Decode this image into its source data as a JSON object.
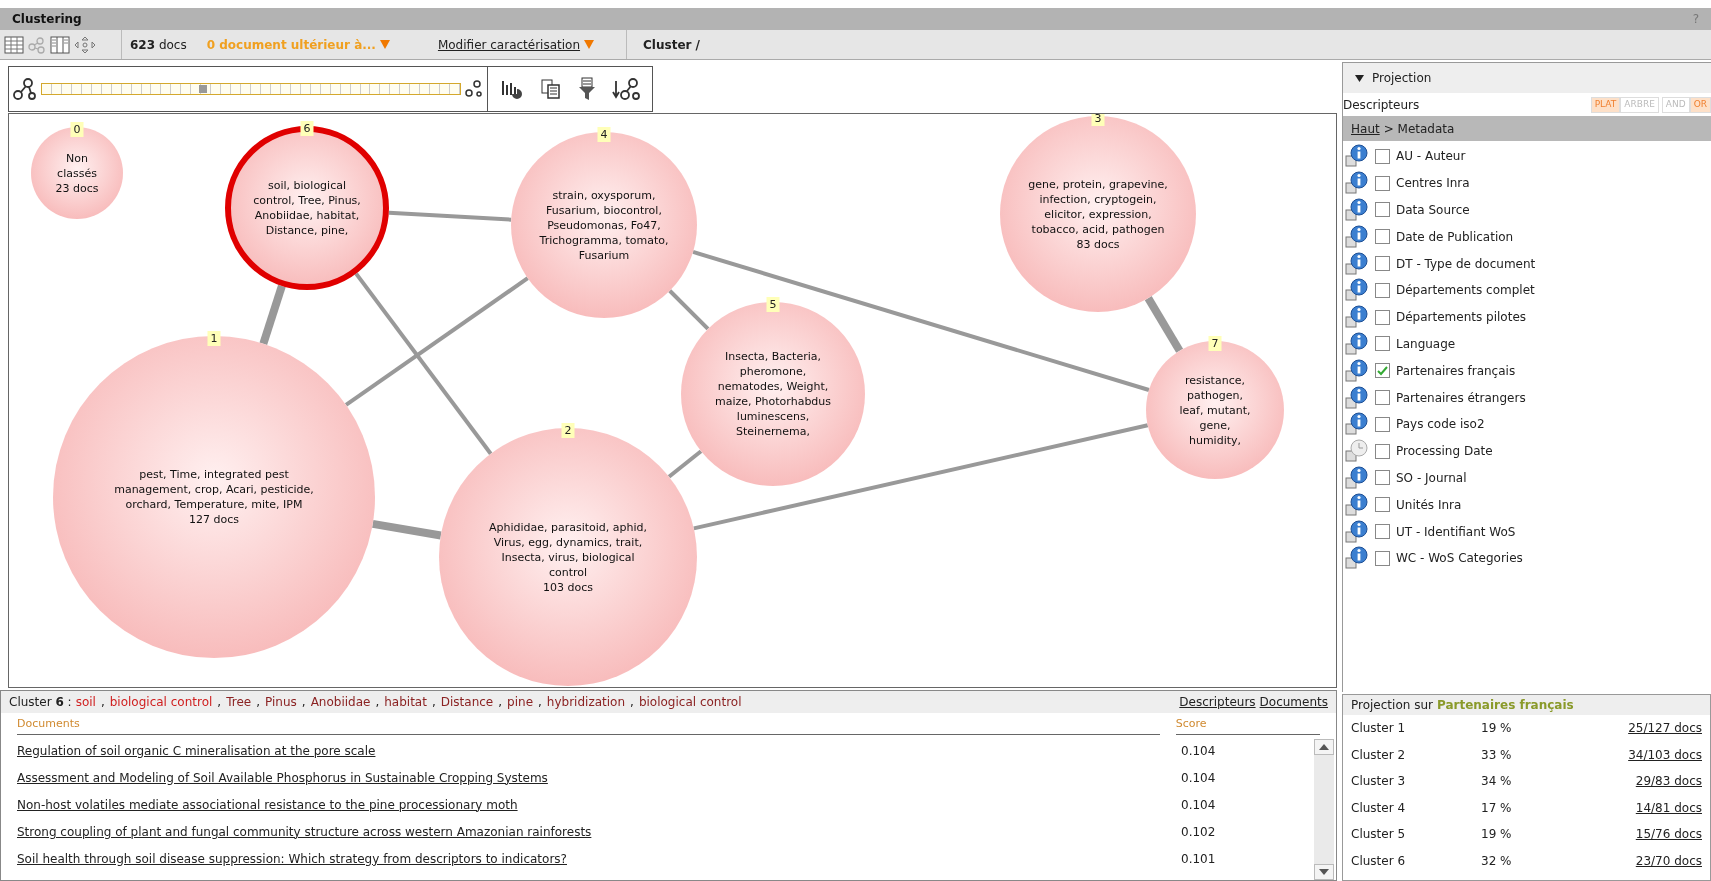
{
  "window": {
    "title": "Clustering",
    "help": "?"
  },
  "toolbar": {
    "doc_count": "**623** docs",
    "later_docs": "0 document ultérieur à...",
    "modify_link": "Modifier caractérisation",
    "cluster_path": "Cluster /"
  },
  "granularity_slider": {
    "level": 0.385
  },
  "nodes": [
    {
      "number": "0",
      "text": "Non classés",
      "docs": "23 docs",
      "selected": false
    },
    {
      "number": "6",
      "text": "soil, biological control, Tree, Pinus, Anobiidae, habitat, Distance, pine,",
      "selected": true
    },
    {
      "number": "4",
      "text": "strain, oxysporum, Fusarium, biocontrol, Pseudomonas, Fo47, Trichogramma, tomato, Fusarium",
      "selected": false
    },
    {
      "number": "3",
      "text": "gene, protein, grapevine, infection, cryptogein, elicitor, expression, tobacco, acid, pathogen",
      "docs": "83 docs",
      "selected": false
    },
    {
      "number": "1",
      "text": "pest, Time, integrated pest management, crop, Acari, pesticide, orchard, Temperature, mite, IPM",
      "docs": "127 docs",
      "selected": false
    },
    {
      "number": "5",
      "text": "Insecta, Bacteria, pheromone, nematodes, Weight, maize, Photorhabdus luminescens, Steinernema,",
      "selected": false
    },
    {
      "number": "2",
      "text": "Aphididae, parasitoid, aphid, Virus, egg, dynamics, trait, Insecta, virus, biological control",
      "docs": "103 docs",
      "selected": false
    },
    {
      "number": "7",
      "text": "resistance, pathogen, leaf, mutant, gene, humidity,",
      "selected": false
    }
  ],
  "cluster_details": {
    "heading": "Cluster **6** :",
    "separator": ",",
    "terms": [
      {
        "text": "soil",
        "highlighted": true
      },
      {
        "text": "biological control",
        "highlighted": true
      },
      {
        "text": "Tree",
        "highlighted": false
      },
      {
        "text": "Pinus",
        "highlighted": false
      },
      {
        "text": "Anobiidae",
        "highlighted": false
      },
      {
        "text": "habitat",
        "highlighted": false
      },
      {
        "text": "Distance",
        "highlighted": false
      },
      {
        "text": "pine",
        "highlighted": false
      },
      {
        "text": "hybridization",
        "highlighted": false
      },
      {
        "text": "biological control",
        "highlighted": false
      }
    ],
    "links": [
      "Descripteurs",
      "Documents"
    ],
    "columns": [
      "Documents",
      "Score"
    ],
    "documents": [
      {
        "title": "Regulation of soil organic C mineralisation at the pore scale",
        "score": "0.104"
      },
      {
        "title": "Assessment and Modeling of Soil Available Phosphorus in Sustainable Cropping Systems",
        "score": "0.104"
      },
      {
        "title": "Non-host volatiles mediate associational resistance to the pine processionary moth",
        "score": "0.104"
      },
      {
        "title": "Strong coupling of plant and fungal community structure across western Amazonian rainforests",
        "score": "0.102"
      },
      {
        "title": "Soil health through soil disease suppression: Which strategy from descriptors to indicators?",
        "score": "0.101"
      }
    ]
  },
  "projection_panel": {
    "title": "Projection",
    "expanded": true,
    "field_label": "Descripteurs",
    "view_modes": [
      {
        "label": "PLAT",
        "selected": true
      },
      {
        "label": "ARBRE",
        "selected": false
      }
    ],
    "operators": [
      {
        "label": "AND",
        "selected": false
      },
      {
        "label": "OR",
        "selected": true
      }
    ],
    "breadcrumb": {
      "link": "Haut",
      "current": "> Metadata"
    },
    "descriptors": [
      {
        "label": "AU - Auteur",
        "checked": false,
        "kind": "info"
      },
      {
        "label": "Centres Inra",
        "checked": false,
        "kind": "info"
      },
      {
        "label": "Data Source",
        "checked": false,
        "kind": "info"
      },
      {
        "label": "Date de Publication",
        "checked": false,
        "kind": "info"
      },
      {
        "label": "DT - Type de document",
        "checked": false,
        "kind": "info"
      },
      {
        "label": "Départements complet",
        "checked": false,
        "kind": "info"
      },
      {
        "label": "Départements pilotes",
        "checked": false,
        "kind": "info"
      },
      {
        "label": "Language",
        "checked": false,
        "kind": "info"
      },
      {
        "label": "Partenaires français",
        "checked": true,
        "kind": "info"
      },
      {
        "label": "Partenaires étrangers",
        "checked": false,
        "kind": "info"
      },
      {
        "label": "Pays code iso2",
        "checked": false,
        "kind": "info"
      },
      {
        "label": "Processing Date",
        "checked": false,
        "kind": "clock"
      },
      {
        "label": "SO - Journal",
        "checked": false,
        "kind": "info"
      },
      {
        "label": "Unités Inra",
        "checked": false,
        "kind": "info"
      },
      {
        "label": "UT - Identifiant WoS",
        "checked": false,
        "kind": "info"
      },
      {
        "label": "WC - WoS Categories",
        "checked": false,
        "kind": "info"
      }
    ]
  },
  "projection_results": {
    "prefix": "Projection sur",
    "field": "Partenaires français",
    "rows": [
      {
        "cluster": "Cluster 1",
        "percent": "19 %",
        "docs": "25/127 docs"
      },
      {
        "cluster": "Cluster 2",
        "percent": "33 %",
        "docs": "34/103 docs"
      },
      {
        "cluster": "Cluster 3",
        "percent": "34 %",
        "docs": "29/83 docs"
      },
      {
        "cluster": "Cluster 4",
        "percent": "17 %",
        "docs": "14/81 docs"
      },
      {
        "cluster": "Cluster 5",
        "percent": "19 %",
        "docs": "15/76 docs"
      },
      {
        "cluster": "Cluster 6",
        "percent": "32 %",
        "docs": "23/70 docs"
      }
    ]
  }
}
